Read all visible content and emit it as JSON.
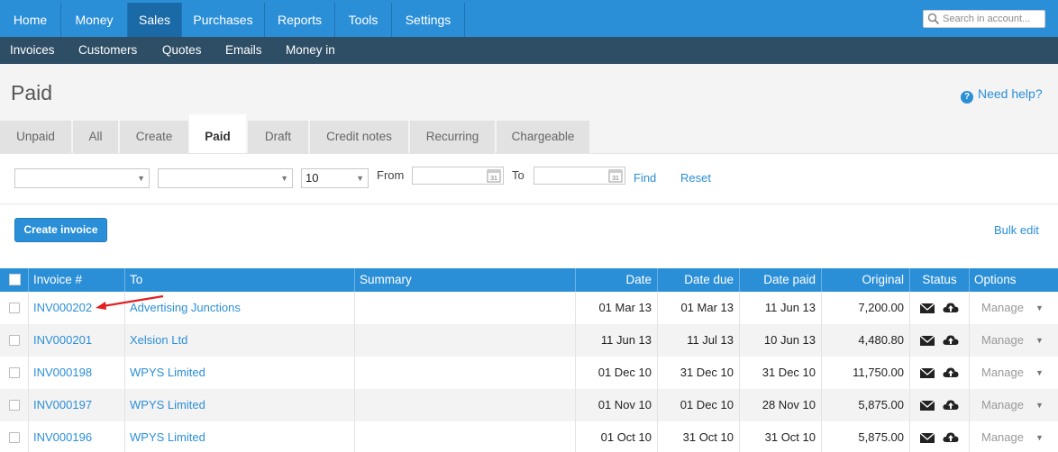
{
  "top_nav": {
    "tabs": [
      "Home",
      "Money",
      "Sales",
      "Purchases",
      "Reports",
      "Tools",
      "Settings"
    ],
    "active": "Sales",
    "search_placeholder": "Search in account..."
  },
  "sub_nav": {
    "items": [
      "Invoices",
      "Customers",
      "Quotes",
      "Emails",
      "Money in"
    ],
    "active": "Invoices"
  },
  "page": {
    "title": "Paid",
    "help_link": "Need help?"
  },
  "tabs": {
    "items": [
      "Unpaid",
      "All",
      "Create",
      "Paid",
      "Draft",
      "Credit notes",
      "Recurring",
      "Chargeable"
    ],
    "active": "Paid"
  },
  "filters": {
    "select1_value": "",
    "select2_value": "",
    "per_page_value": "10",
    "from_label": "From",
    "from_value": "",
    "to_label": "To",
    "to_value": "",
    "calendar_day": "31",
    "find_label": "Find",
    "reset_label": "Reset"
  },
  "actions": {
    "create_invoice": "Create invoice",
    "bulk_edit": "Bulk edit"
  },
  "table": {
    "headers": {
      "invoice": "Invoice #",
      "to": "To",
      "summary": "Summary",
      "date": "Date",
      "date_due": "Date due",
      "date_paid": "Date paid",
      "original": "Original",
      "status": "Status",
      "options": "Options"
    },
    "manage_label": "Manage",
    "rows": [
      {
        "invoice": "INV000202",
        "to": "Advertising Junctions",
        "summary": "",
        "date": "01 Mar 13",
        "date_due": "01 Mar 13",
        "date_paid": "11 Jun 13",
        "original": "7,200.00"
      },
      {
        "invoice": "INV000201",
        "to": "Xelsion Ltd",
        "summary": "",
        "date": "11 Jun 13",
        "date_due": "11 Jul 13",
        "date_paid": "10 Jun 13",
        "original": "4,480.80"
      },
      {
        "invoice": "INV000198",
        "to": "WPYS Limited",
        "summary": "",
        "date": "01 Dec 10",
        "date_due": "31 Dec 10",
        "date_paid": "31 Dec 10",
        "original": "11,750.00"
      },
      {
        "invoice": "INV000197",
        "to": "WPYS Limited",
        "summary": "",
        "date": "01 Nov 10",
        "date_due": "01 Dec 10",
        "date_paid": "28 Nov 10",
        "original": "5,875.00"
      },
      {
        "invoice": "INV000196",
        "to": "WPYS Limited",
        "summary": "",
        "date": "01 Oct 10",
        "date_due": "31 Oct 10",
        "date_paid": "31 Oct 10",
        "original": "5,875.00"
      }
    ]
  },
  "colors": {
    "primary": "#2b8fd8",
    "active_nav": "#1b6aa8",
    "sub_nav": "#2e4e66",
    "annotation_arrow": "#e02020"
  }
}
